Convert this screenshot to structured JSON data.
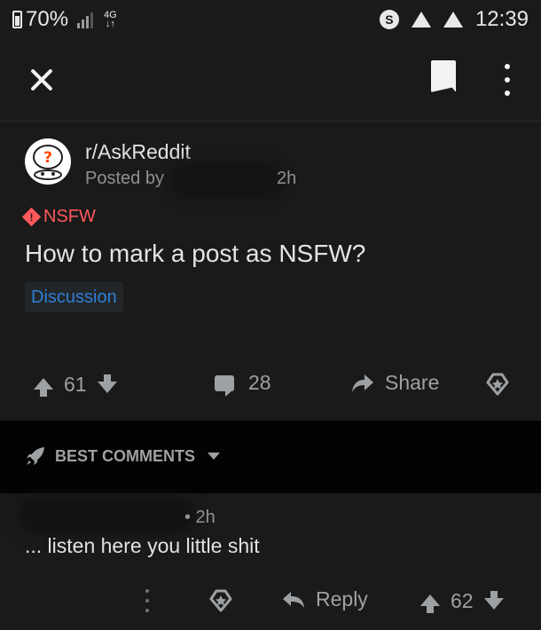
{
  "status_bar": {
    "battery": "70%",
    "network": "4G",
    "time": "12:39"
  },
  "toolbar": {
    "close_icon": "close-icon",
    "bookmark_icon": "bookmark-icon",
    "menu_icon": "more-vertical-icon"
  },
  "post": {
    "subreddit": "r/AskReddit",
    "posted_by": "Posted by",
    "time": "2h",
    "nsfw_label": "NSFW",
    "title": "How to mark a post as NSFW?",
    "flair": "Discussion",
    "votes": "61",
    "comments": "28",
    "share_label": "Share"
  },
  "comments_section": {
    "sort_label": "BEST COMMENTS"
  },
  "comment": {
    "time": "• 2h",
    "body": "... listen here you little shit",
    "reply_label": "Reply",
    "votes": "62"
  },
  "colors": {
    "background": "#1a1a1b",
    "nsfw": "#ff585b",
    "flair_text": "#2d7fd6",
    "muted_text": "#9ea1a3"
  }
}
